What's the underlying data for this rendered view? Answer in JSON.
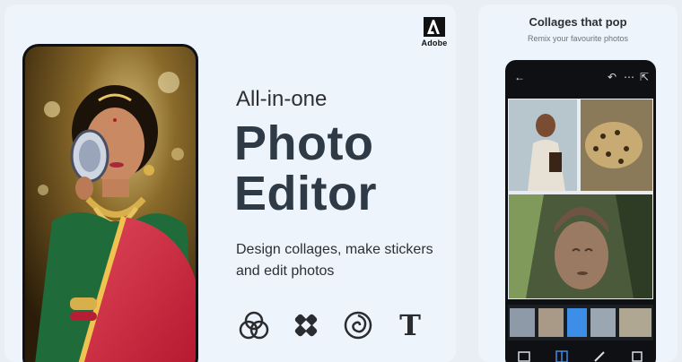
{
  "brand": {
    "name": "Adobe"
  },
  "hero": {
    "overline": "All-in-one",
    "title_line1": "Photo",
    "title_line2": "Editor",
    "subtitle": "Design collages, make stickers and edit photos"
  },
  "feature_icons": [
    "overlapping-circles-icon",
    "bandage-sticker-icon",
    "swirl-icon",
    "text-t-icon"
  ],
  "feature_text_glyph": "T",
  "right_panel": {
    "title": "Collages that pop",
    "subtitle": "Remix your favourite photos"
  },
  "colors": {
    "card_bg": "#eef4fb",
    "title": "#2f3a47",
    "accent": "#3d8ee6"
  }
}
